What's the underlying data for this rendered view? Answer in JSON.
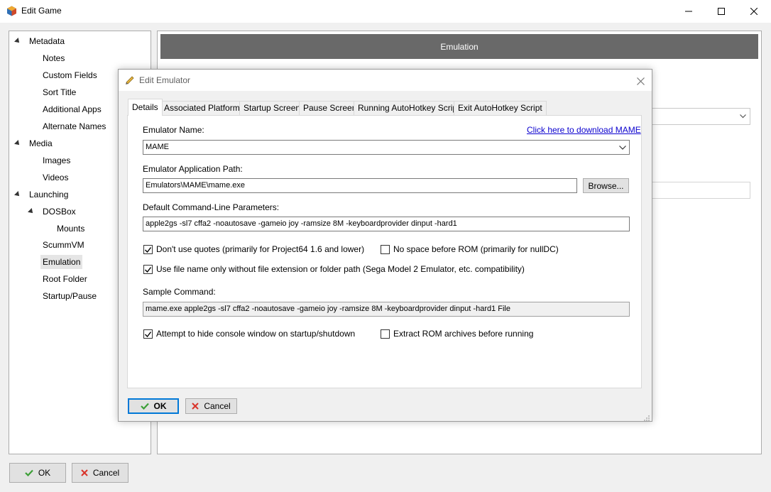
{
  "window": {
    "title": "Edit Game",
    "controls": {
      "minimize": "–",
      "maximize": "☐",
      "close": "✕"
    }
  },
  "tree": {
    "items": [
      {
        "label": "Metadata",
        "expanded": true
      },
      {
        "label": "Notes"
      },
      {
        "label": "Custom Fields"
      },
      {
        "label": "Sort Title"
      },
      {
        "label": "Additional Apps"
      },
      {
        "label": "Alternate Names"
      },
      {
        "label": "Media",
        "expanded": true
      },
      {
        "label": "Images"
      },
      {
        "label": "Videos"
      },
      {
        "label": "Launching",
        "expanded": true
      },
      {
        "label": "DOSBox",
        "expanded": true
      },
      {
        "label": "Mounts"
      },
      {
        "label": "ScummVM"
      },
      {
        "label": "Emulation",
        "selected": true
      },
      {
        "label": "Root Folder"
      },
      {
        "label": "Startup/Pause"
      }
    ]
  },
  "panel": {
    "header": "Emulation"
  },
  "buttons": {
    "ok": "OK",
    "cancel": "Cancel"
  },
  "dialog": {
    "title": "Edit Emulator",
    "tabs": [
      {
        "label": "Details",
        "active": true
      },
      {
        "label": "Associated Platforms"
      },
      {
        "label": "Startup Screen"
      },
      {
        "label": "Pause Screen"
      },
      {
        "label": "Running AutoHotkey Script"
      },
      {
        "label": "Exit AutoHotkey Script"
      }
    ],
    "emulator_name_label": "Emulator Name:",
    "download_link": "Click here to download MAME",
    "emulator_name_value": "MAME",
    "app_path_label": "Emulator Application Path:",
    "app_path_value": "Emulators\\MAME\\mame.exe",
    "browse_label": "Browse...",
    "params_label": "Default Command-Line Parameters:",
    "params_value": "apple2gs -sl7 cffa2 -noautosave -gameio joy -ramsize 8M -keyboardprovider dinput -hard1",
    "checkboxes": {
      "no_quotes": {
        "label": "Don't use quotes (primarily for Project64 1.6 and lower)",
        "checked": true
      },
      "no_space": {
        "label": "No space before ROM (primarily for nullDC)",
        "checked": false
      },
      "file_name_only": {
        "label": "Use file name only without file extension or folder path (Sega Model 2 Emulator, etc. compatibility)",
        "checked": true
      },
      "hide_console": {
        "label": "Attempt to hide console window on startup/shutdown",
        "checked": true
      },
      "extract_rom": {
        "label": "Extract ROM archives before running",
        "checked": false
      }
    },
    "sample_label": "Sample Command:",
    "sample_value": "mame.exe apple2gs -sl7 cffa2 -noautosave -gameio joy -ramsize 8M -keyboardprovider dinput -hard1 File",
    "ok_label": "OK",
    "cancel_label": "Cancel"
  },
  "colors": {
    "accent": "#0078d7",
    "header_bg": "#696969",
    "ok_icon": "#3c9f37",
    "cancel_icon": "#d9342b",
    "link": "#0a00ce"
  }
}
